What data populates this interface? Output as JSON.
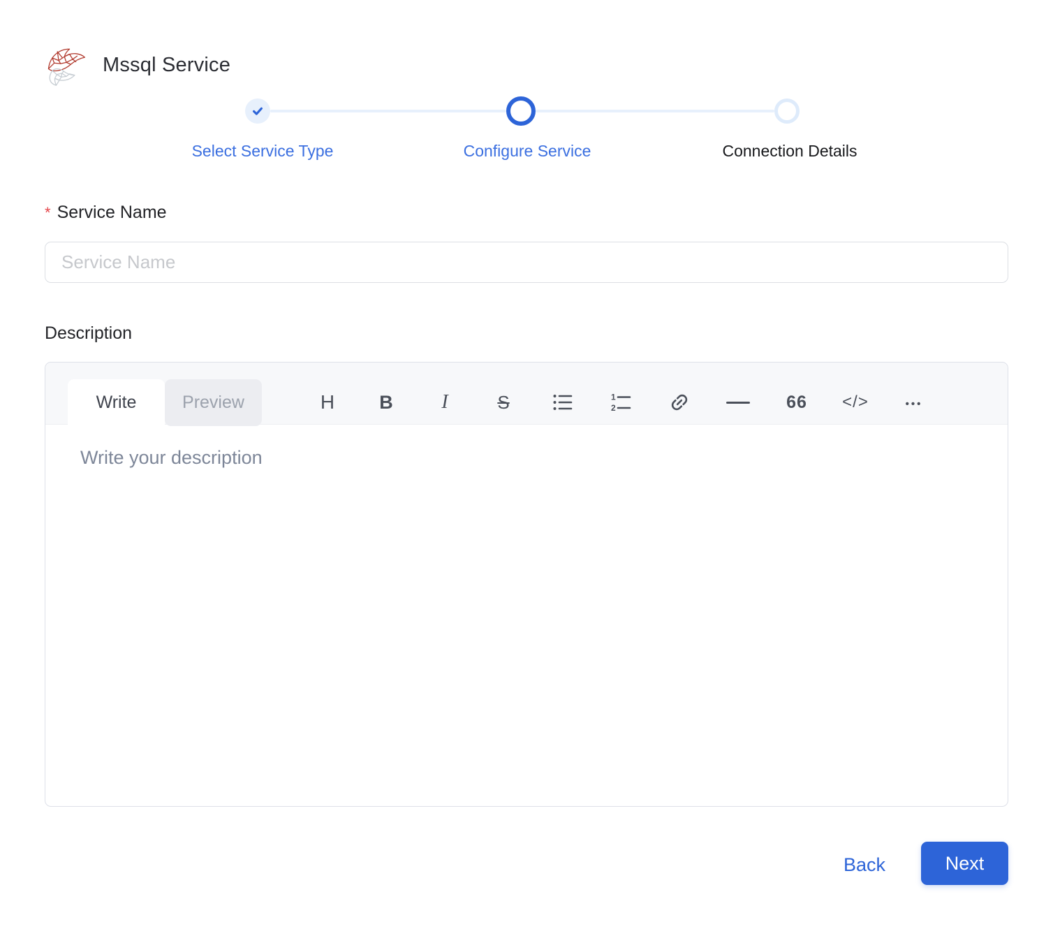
{
  "header": {
    "title": "Mssql Service",
    "logo": "mssql-server-logo"
  },
  "stepper": {
    "steps": [
      {
        "label": "Select Service Type",
        "state": "completed"
      },
      {
        "label": "Configure Service",
        "state": "current"
      },
      {
        "label": "Connection Details",
        "state": "upcoming"
      }
    ]
  },
  "form": {
    "service_name": {
      "required_marker": "*",
      "label": "Service Name",
      "placeholder": "Service Name",
      "value": ""
    },
    "description": {
      "label": "Description",
      "active_tab": "Write",
      "tabs": [
        {
          "label": "Write"
        },
        {
          "label": "Preview"
        }
      ],
      "toolbar_items": [
        "heading",
        "bold",
        "italic",
        "strikethrough",
        "unordered-list",
        "ordered-list",
        "link",
        "horizontal-rule",
        "quote",
        "code",
        "more"
      ],
      "toolbar_glyphs": {
        "heading": "H",
        "bold": "B",
        "italic": "I",
        "strikethrough": "S",
        "quote": "66",
        "code": "</>",
        "more": "•••"
      },
      "placeholder": "Write your description",
      "value": ""
    }
  },
  "actions": {
    "back_label": "Back",
    "next_label": "Next"
  },
  "colors": {
    "accent": "#2D64D8",
    "accent_text": "#3B6FE0",
    "accent_light": "#E7F0FC",
    "upcoming_ring": "#DEEBFB",
    "title_text": "#2B2D33",
    "body_text": "#222327",
    "muted_text": "#9CA2AD",
    "input_placeholder": "#C6C8CC",
    "editor_placeholder": "#7D8698",
    "border": "#DCDFE4",
    "editor_border": "#DDE0E8",
    "editor_header_bg": "#F7F8FA",
    "preview_tab_bg": "#ECEDF1",
    "icon": "#4A4F59",
    "required": "#E5484D",
    "logo_red": "#B13A2E",
    "logo_gray": "#C7CDD3",
    "button_text": "#FFFFFF"
  }
}
